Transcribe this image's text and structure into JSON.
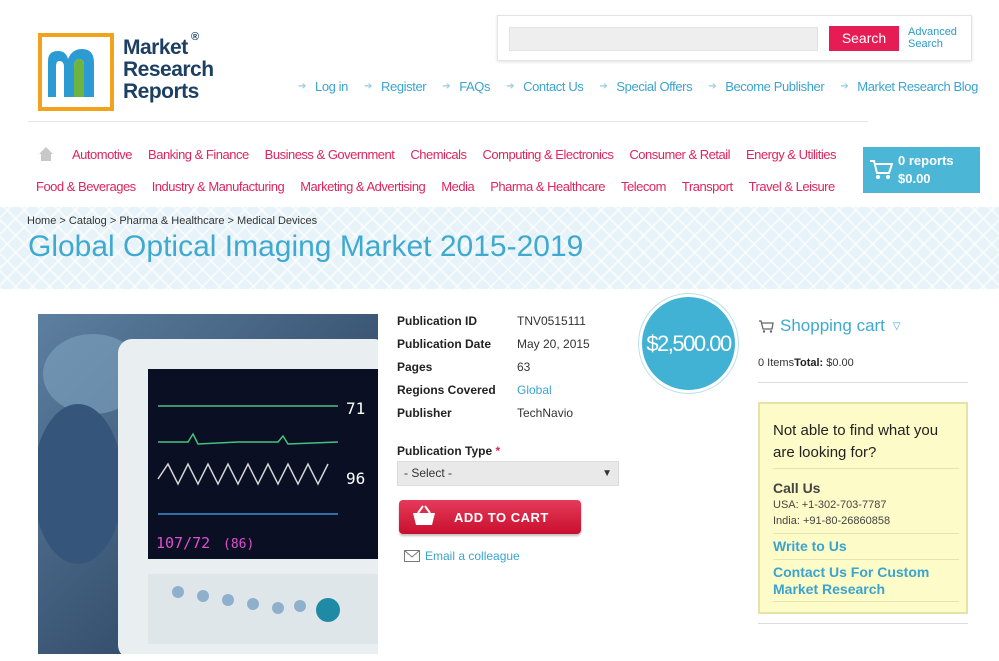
{
  "logo": {
    "line1": "Market",
    "line2": "Research",
    "line3": "Reports",
    "reg": "®"
  },
  "search": {
    "button": "Search",
    "advanced_line1": "Advanced",
    "advanced_line2": "Search"
  },
  "top_links": [
    "Log in",
    "Register",
    "FAQs",
    "Contact Us",
    "Special Offers",
    "Become Publisher",
    "Market Research Blog"
  ],
  "categories_row1": [
    "Automotive",
    "Banking & Finance",
    "Business & Government",
    "Chemicals",
    "Computing & Electronics",
    "Consumer & Retail",
    "Energy & Utilities"
  ],
  "categories_row2": [
    "Food & Beverages",
    "Industry & Manufacturing",
    "Marketing & Advertising",
    "Media",
    "Pharma & Healthcare",
    "Telecom",
    "Transport",
    "Travel & Leisure"
  ],
  "cart": {
    "count": "0 reports",
    "total": "$0.00"
  },
  "breadcrumb": "Home > Catalog > Pharma & Healthcare > Medical Devices",
  "page_title": "Global Optical Imaging Market 2015-2019",
  "monitor": {
    "v1": "71",
    "v2": "96",
    "bp": "107/72",
    "bp2": "(86)"
  },
  "info": [
    {
      "label": "Publication ID",
      "value": "TNV0515111"
    },
    {
      "label": "Publication Date",
      "value": "May 20, 2015"
    },
    {
      "label": "Pages",
      "value": "63"
    },
    {
      "label": "Regions Covered",
      "value": "Global"
    },
    {
      "label": "Publisher",
      "value": "TechNavio"
    }
  ],
  "publication_type": {
    "label": "Publication Type",
    "required": "*",
    "selected": "- Select -"
  },
  "add_to_cart": "ADD TO CART",
  "email_colleague": "Email a colleague",
  "price": "$2,500.00",
  "shopping_cart": {
    "title": "Shopping cart",
    "items": "0 Items",
    "total_label": "Total:",
    "total_value": "$0.00"
  },
  "help": {
    "question": "Not able to find what you are looking for?",
    "call_us": "Call Us",
    "usa": "USA: +1-302-703-7787",
    "india": "India: +91-80-26860858",
    "write": "Write to Us",
    "custom": "Contact Us For Custom Market Research"
  },
  "colors": {
    "accent": "#3fa9d0",
    "pink": "#e0245e",
    "cart_bg": "#4bb6d6",
    "help_bg": "#fdfbc7"
  }
}
